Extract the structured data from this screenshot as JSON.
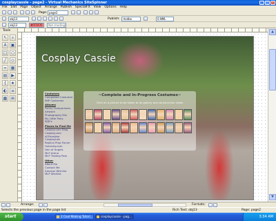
{
  "window": {
    "title": "cosplaycassie - page2 - Virtual Mechanics SiteSpinner",
    "buttons": [
      "_",
      "□",
      "×"
    ]
  },
  "menu": [
    "File",
    "Edit",
    "Page",
    "Object",
    "Arrange",
    "Publish",
    "SpecialFX",
    "View",
    "Options",
    "Help"
  ],
  "toolbar": {
    "page_label": "Page:",
    "page_value": "page2",
    "publish_label": "Publish:",
    "publish_value": "rtxdbo",
    "publish_value2": "0.NML",
    "object_name": "obj13",
    "color_value": "#FF7F7F",
    "ready_text": "Not shading(s)",
    "zoom": "100%"
  },
  "tools": {
    "label": "Tools",
    "icons": [
      "pointer-icon",
      "zoom-icon",
      "text-icon",
      "image-icon",
      "rectangle-icon",
      "ellipse-icon",
      "line-icon",
      "polygon-icon",
      "link-icon",
      "table-icon",
      "form-icon",
      "media-icon",
      "script-icon",
      "shape-icon",
      "color-icon",
      "layer-icon",
      "group-icon",
      "align-icon"
    ]
  },
  "site": {
    "title": "Cosplay Cassie",
    "panel_title": "~Complete and In-Progress Costumes~",
    "panel_sub": "Click on a picture to be taken to its gallery and construction notes",
    "thumb_colors": [
      "#e9c9a4",
      "#c44d6a",
      "#f1d7b0",
      "#6a4f8a",
      "#e0c39a",
      "#d06060",
      "#f5e0c0",
      "#4b6fb0",
      "#e6b26a",
      "#d88ab0",
      "#f0d4a0",
      "#5a8e5e",
      "#c9955f",
      "#f2d3a8",
      "#8a5ea8",
      "#e0b080",
      "#b04040",
      "#f0c090",
      "#6a8ad0",
      "#e8a0b8",
      "#d0a060",
      "#7aa0c0",
      "#e0c0a0",
      "#a06080"
    ]
  },
  "sidebar": {
    "sections": [
      {
        "heading": "Costumes",
        "links": [
          "Completed Costumes",
          "WIP Costumes"
        ]
      },
      {
        "heading": "Albums",
        "links": [
          "Funny Comparisons",
          "Artwork",
          "Photography Mix",
          "My Little Pony",
          "SJID's"
        ]
      },
      {
        "heading": "Places to Find Me",
        "links": [
          "Cosplay.com Blog",
          "Cosplay.com",
          "ACParadise",
          "CosplayLab",
          "Replica Prop Forum",
          "Hutsicity.com",
          "Den of Angels",
          "MLP Arena",
          "MLP Trading Post"
        ]
      },
      {
        "heading": "Other",
        "links": [
          "About Me",
          "Contact Me",
          "Amazon Wishlist",
          "MLP Wishlist"
        ]
      }
    ]
  },
  "bottom": {
    "arrange": "Arrange:",
    "formats": "Formats:",
    "status_left": "Selects the previous page in the page list",
    "status_mid": "Rich Text: obj13",
    "status_right": "Page: page2"
  },
  "taskbar": {
    "start": "start",
    "tasks": [
      "2 Cool Making Tutori...",
      "cosplaycassie - pag..."
    ],
    "clock": "3:34 AM"
  }
}
